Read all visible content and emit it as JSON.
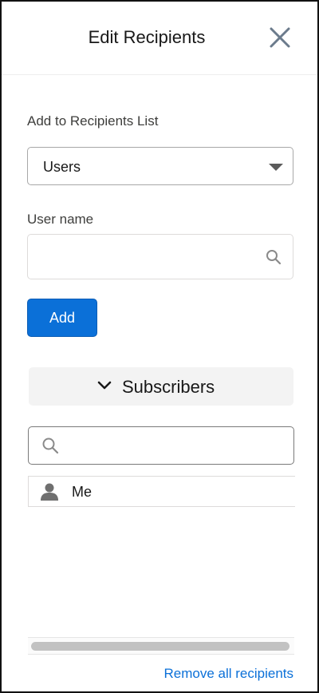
{
  "header": {
    "title": "Edit Recipients",
    "close_icon": "close-icon"
  },
  "form": {
    "list_label": "Add to Recipients List",
    "list_select_value": "Users",
    "user_label": "User name",
    "user_placeholder": "",
    "add_label": "Add"
  },
  "subscribers": {
    "title": "Subscribers",
    "filter_placeholder": "",
    "items": [
      {
        "label": "Me",
        "icon": "user-icon"
      }
    ]
  },
  "footer": {
    "remove_all_label": "Remove all recipients"
  },
  "colors": {
    "accent": "#0b70d8",
    "close_icon": "#6b7b8c"
  }
}
